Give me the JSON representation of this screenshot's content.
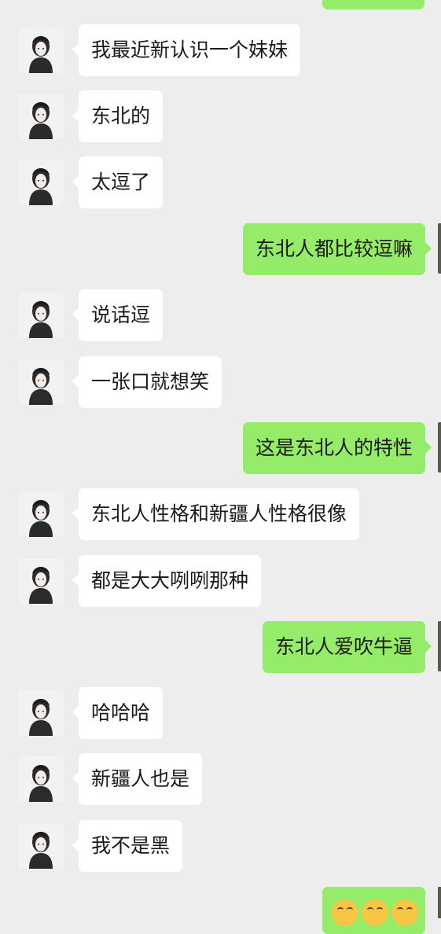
{
  "colors": {
    "background": "#ededed",
    "incoming_bubble": "#ffffff",
    "outgoing_bubble": "#95ec69",
    "text": "#1a1a1a"
  },
  "messages": [
    {
      "side": "in",
      "text": "我最近新认识一个妹妹"
    },
    {
      "side": "in",
      "text": "东北的"
    },
    {
      "side": "in",
      "text": "太逗了"
    },
    {
      "side": "out",
      "text": "东北人都比较逗嘛"
    },
    {
      "side": "in",
      "text": "说话逗"
    },
    {
      "side": "in",
      "text": "一张口就想笑"
    },
    {
      "side": "out",
      "text": "这是东北人的特性"
    },
    {
      "side": "in",
      "text": "东北人性格和新疆人性格很像"
    },
    {
      "side": "in",
      "text": "都是大大咧咧那种"
    },
    {
      "side": "out",
      "text": "东北人爱吹牛逼"
    },
    {
      "side": "in",
      "text": "哈哈哈"
    },
    {
      "side": "in",
      "text": "新疆人也是"
    },
    {
      "side": "in",
      "text": "我不是黑"
    }
  ],
  "final_message": {
    "side": "out",
    "content": "emoji",
    "icon": "laughing-emoji-icon",
    "count": 3
  }
}
